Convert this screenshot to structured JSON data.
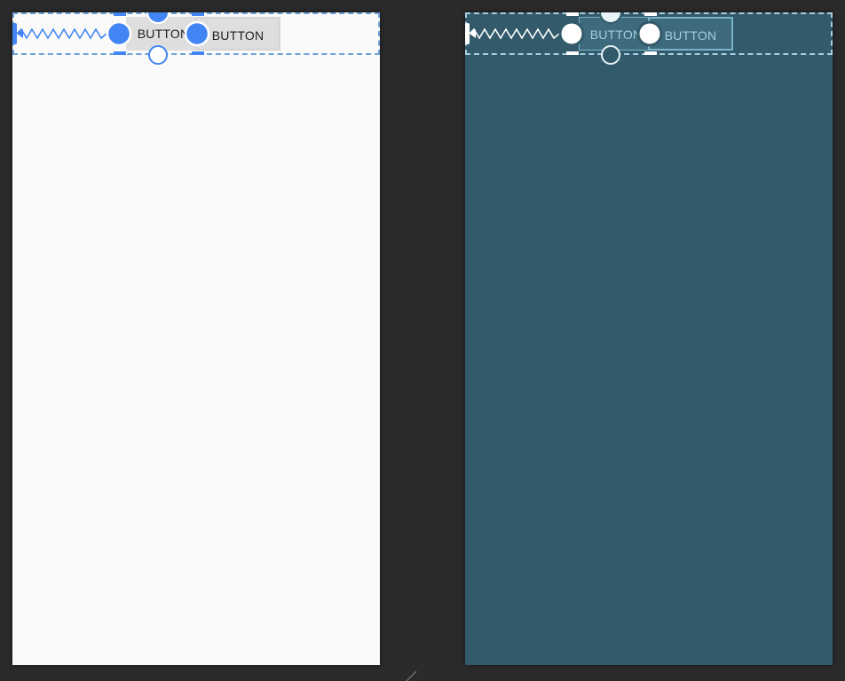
{
  "design_view": {
    "buttons": [
      {
        "label": "BUTTON"
      },
      {
        "label": "BUTTON"
      }
    ]
  },
  "blueprint_view": {
    "buttons": [
      {
        "label": "BUTTON"
      },
      {
        "label": "BUTTON"
      }
    ]
  },
  "icons": {
    "chain_spring": "spring-icon",
    "anchor": "anchor-handle-icon",
    "resize": "resize-handle-icon"
  },
  "colors": {
    "canvas": "#2b2b2c",
    "design_background": "#fafafa",
    "blueprint_background": "#335a6b",
    "selection_accent": "#4285f4",
    "blueprint_accent": "#a7cfe0"
  }
}
